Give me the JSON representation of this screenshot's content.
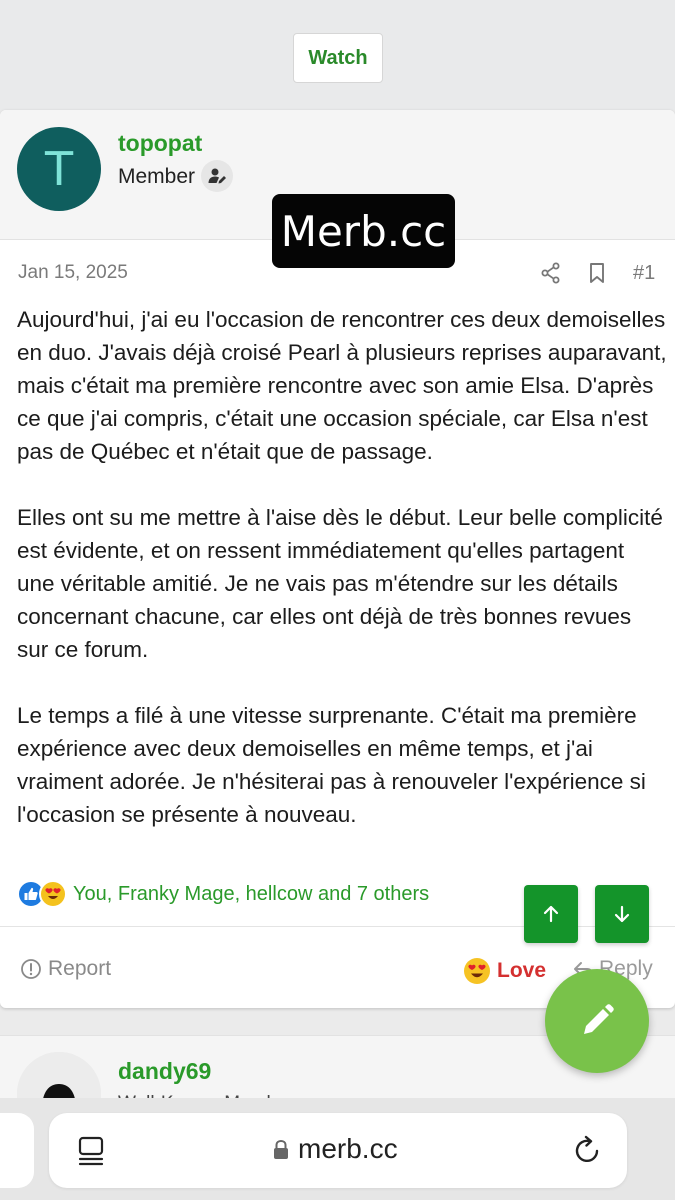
{
  "top": {
    "watch_label": "Watch"
  },
  "post": {
    "author": {
      "avatar_letter": "T",
      "username": "topopat",
      "role": "Member"
    },
    "date": "Jan 15, 2025",
    "post_number": "#1",
    "body": [
      "Aujourd'hui, j'ai eu l'occasion de rencontrer ces deux demoiselles en duo. J'avais déjà croisé Pearl à plusieurs reprises auparavant, mais c'était ma première rencontre avec son amie Elsa. D'après ce que j'ai compris, c'était une occasion spéciale, car Elsa n'est pas de Québec et n'était que de passage.",
      "Elles ont su me mettre à l'aise dès le début. Leur belle complicité est évidente, et on ressent immédiatement qu'elles partagent une véritable amitié. Je ne vais pas m'étendre sur les détails concernant chacune, car elles ont déjà de très bonnes revues sur ce forum.",
      "Le temps a filé à une vitesse surprenante. C'était ma première expérience avec deux demoiselles en même temps, et j'ai vraiment adorée. Je n'hésiterai pas à renouveler l'expérience si l'occasion se présente à nouveau."
    ],
    "reactions_text": "You, Franky Mage, hellcow and 7 others",
    "actions": {
      "report_label": "Report",
      "love_label": "Love",
      "reply_label": "Reply"
    }
  },
  "watermark": "Merb.cc",
  "next_post": {
    "username": "dandy69",
    "role": "Well-Known Member"
  },
  "browser": {
    "url": "merb.cc"
  },
  "colors": {
    "brand_green": "#2a9a2a",
    "vote_green": "#14942a",
    "fab_green": "#79c24a",
    "love_red": "#d43030"
  }
}
